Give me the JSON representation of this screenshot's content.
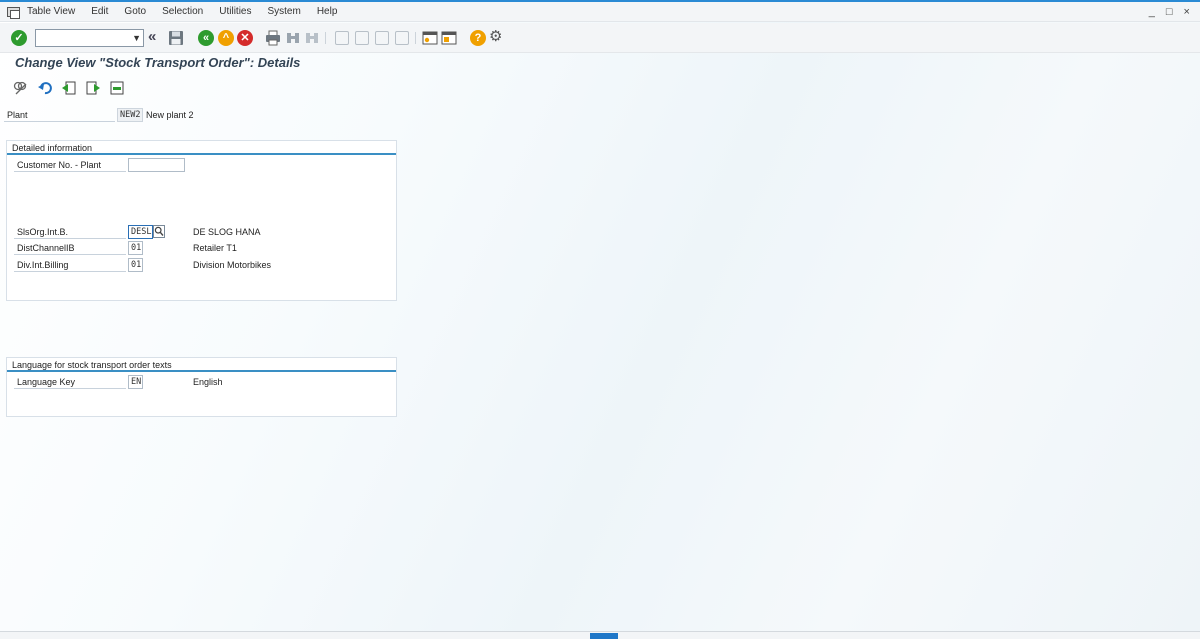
{
  "menubar": {
    "items": [
      "Table View",
      "Edit",
      "Goto",
      "Selection",
      "Utilities",
      "System",
      "Help"
    ],
    "window_controls": "_ □ ×"
  },
  "toolbar": {
    "command_field_value": "",
    "icons": {
      "enter": "check-icon",
      "save": "save-icon",
      "back": "back-icon",
      "exit": "exit-icon",
      "cancel": "cancel-icon",
      "print": "print-icon",
      "find": "find-icon",
      "help": "help-icon",
      "settings": "gear-icon"
    },
    "colors": {
      "enter": "#2e9b2e",
      "back": "#2e9b2e",
      "exit": "#f0a000",
      "cancel": "#d42b2b",
      "help": "#f0a000"
    }
  },
  "page": {
    "title": "Change View \"Stock Transport Order\": Details"
  },
  "header_fields": {
    "plant_label": "Plant",
    "plant_value": "NEW2",
    "plant_desc": "New plant 2"
  },
  "detailed_info": {
    "title": "Detailed information",
    "customer_label": "Customer No. - Plant",
    "customer_value": "",
    "salesorg_label": "SlsOrg.Int.B.",
    "salesorg_value": "DESL",
    "salesorg_desc": "DE SLOG HANA",
    "distchannel_label": "DistChannelIB",
    "distchannel_value": "01",
    "distchannel_desc": "Retailer T1",
    "division_label": "Div.Int.Billing",
    "division_value": "01",
    "division_desc": "Division Motorbikes"
  },
  "language": {
    "title": "Language for stock transport order texts",
    "key_label": "Language Key",
    "key_value": "EN",
    "key_desc": "English"
  }
}
